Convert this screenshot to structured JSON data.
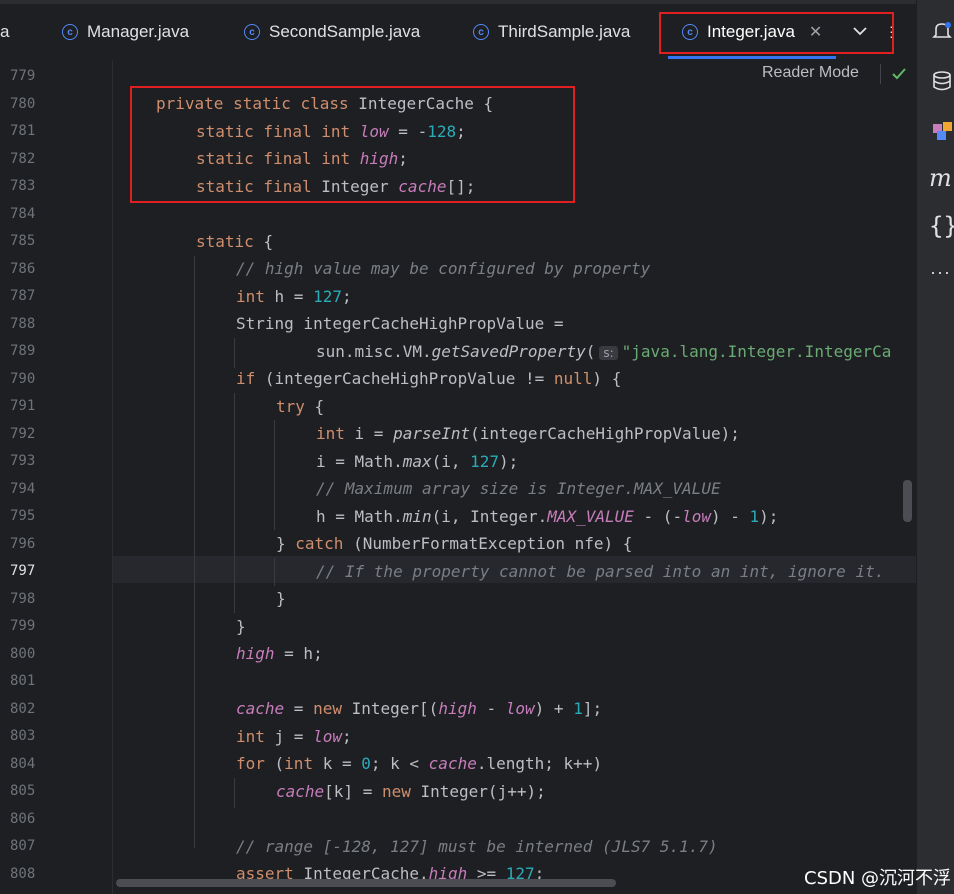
{
  "tabs": [
    {
      "label": "a",
      "icon": "none"
    },
    {
      "label": "Manager.java",
      "icon": "class-icon"
    },
    {
      "label": "SecondSample.java",
      "icon": "class-icon"
    },
    {
      "label": "ThirdSample.java",
      "icon": "class-icon"
    },
    {
      "label": "Integer.java",
      "icon": "class-icon",
      "active": true
    }
  ],
  "editor": {
    "reader_mode": "Reader Mode",
    "line_numbers": [
      "779",
      "780",
      "781",
      "782",
      "783",
      "784",
      "785",
      "786",
      "787",
      "788",
      "789",
      "790",
      "791",
      "792",
      "793",
      "794",
      "795",
      "796",
      "797",
      "798",
      "799",
      "800",
      "801",
      "802",
      "803",
      "804",
      "805",
      "806",
      "807",
      "808"
    ],
    "current_line": "797",
    "param_hint": "s:"
  },
  "watermark": "CSDN @沉河不浮",
  "colors": {
    "keyword": "#cf8e6d",
    "number": "#2aacb8",
    "comment": "#7a7e85",
    "field": "#c77dbb",
    "string": "#6aab73",
    "highlight_box": "#e02020",
    "accent": "#3574f0"
  }
}
